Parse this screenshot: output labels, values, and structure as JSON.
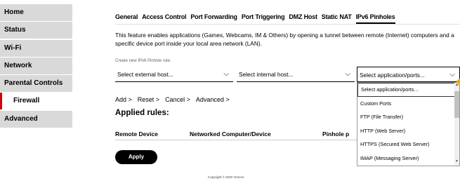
{
  "sidebar": {
    "items": [
      {
        "label": "Home"
      },
      {
        "label": "Status"
      },
      {
        "label": "Wi-Fi"
      },
      {
        "label": "Network"
      },
      {
        "label": "Parental Controls"
      },
      {
        "label": "Firewall",
        "active": true
      },
      {
        "label": "Advanced"
      }
    ]
  },
  "tabs": [
    {
      "label": "General"
    },
    {
      "label": "Access Control"
    },
    {
      "label": "Port Forwarding"
    },
    {
      "label": "Port Triggering"
    },
    {
      "label": "DMZ Host"
    },
    {
      "label": "Static NAT"
    },
    {
      "label": "IPv6 Pinholes",
      "active": true
    }
  ],
  "description": {
    "line1": "This feature enables applications (Games, Webcams, IM & Others) by opening a tunnel between remote (Internet) computers and a",
    "line2": "specific device port inside your local area network (LAN)."
  },
  "form": {
    "rule_label": "Create new IPv6 Pinhole rule:",
    "external_host": "Select external host...",
    "internal_host": "Select internal host...",
    "app_ports": "Select application/ports..."
  },
  "links": {
    "add": "Add >",
    "reset": "Reset >",
    "cancel": "Cancel >",
    "advanced": "Advanced >"
  },
  "applied": {
    "title": "Applied rules:",
    "columns": [
      "Remote Device",
      "Networked Computer/Device",
      "Pinhole p"
    ]
  },
  "apply_label": "Apply",
  "copyright": "Copyright © 2020 Verizon",
  "dropdown": {
    "options": [
      "Select application/ports...",
      "Custom Ports",
      "FTP (File Transfer)",
      "HTTP (Web Server)",
      "HTTPS (Secured Web Server)",
      "IMAP (Messaging Server)"
    ]
  },
  "colors": {
    "accent": "#cd040b",
    "sidebar_bg": "#d9d9d9"
  }
}
